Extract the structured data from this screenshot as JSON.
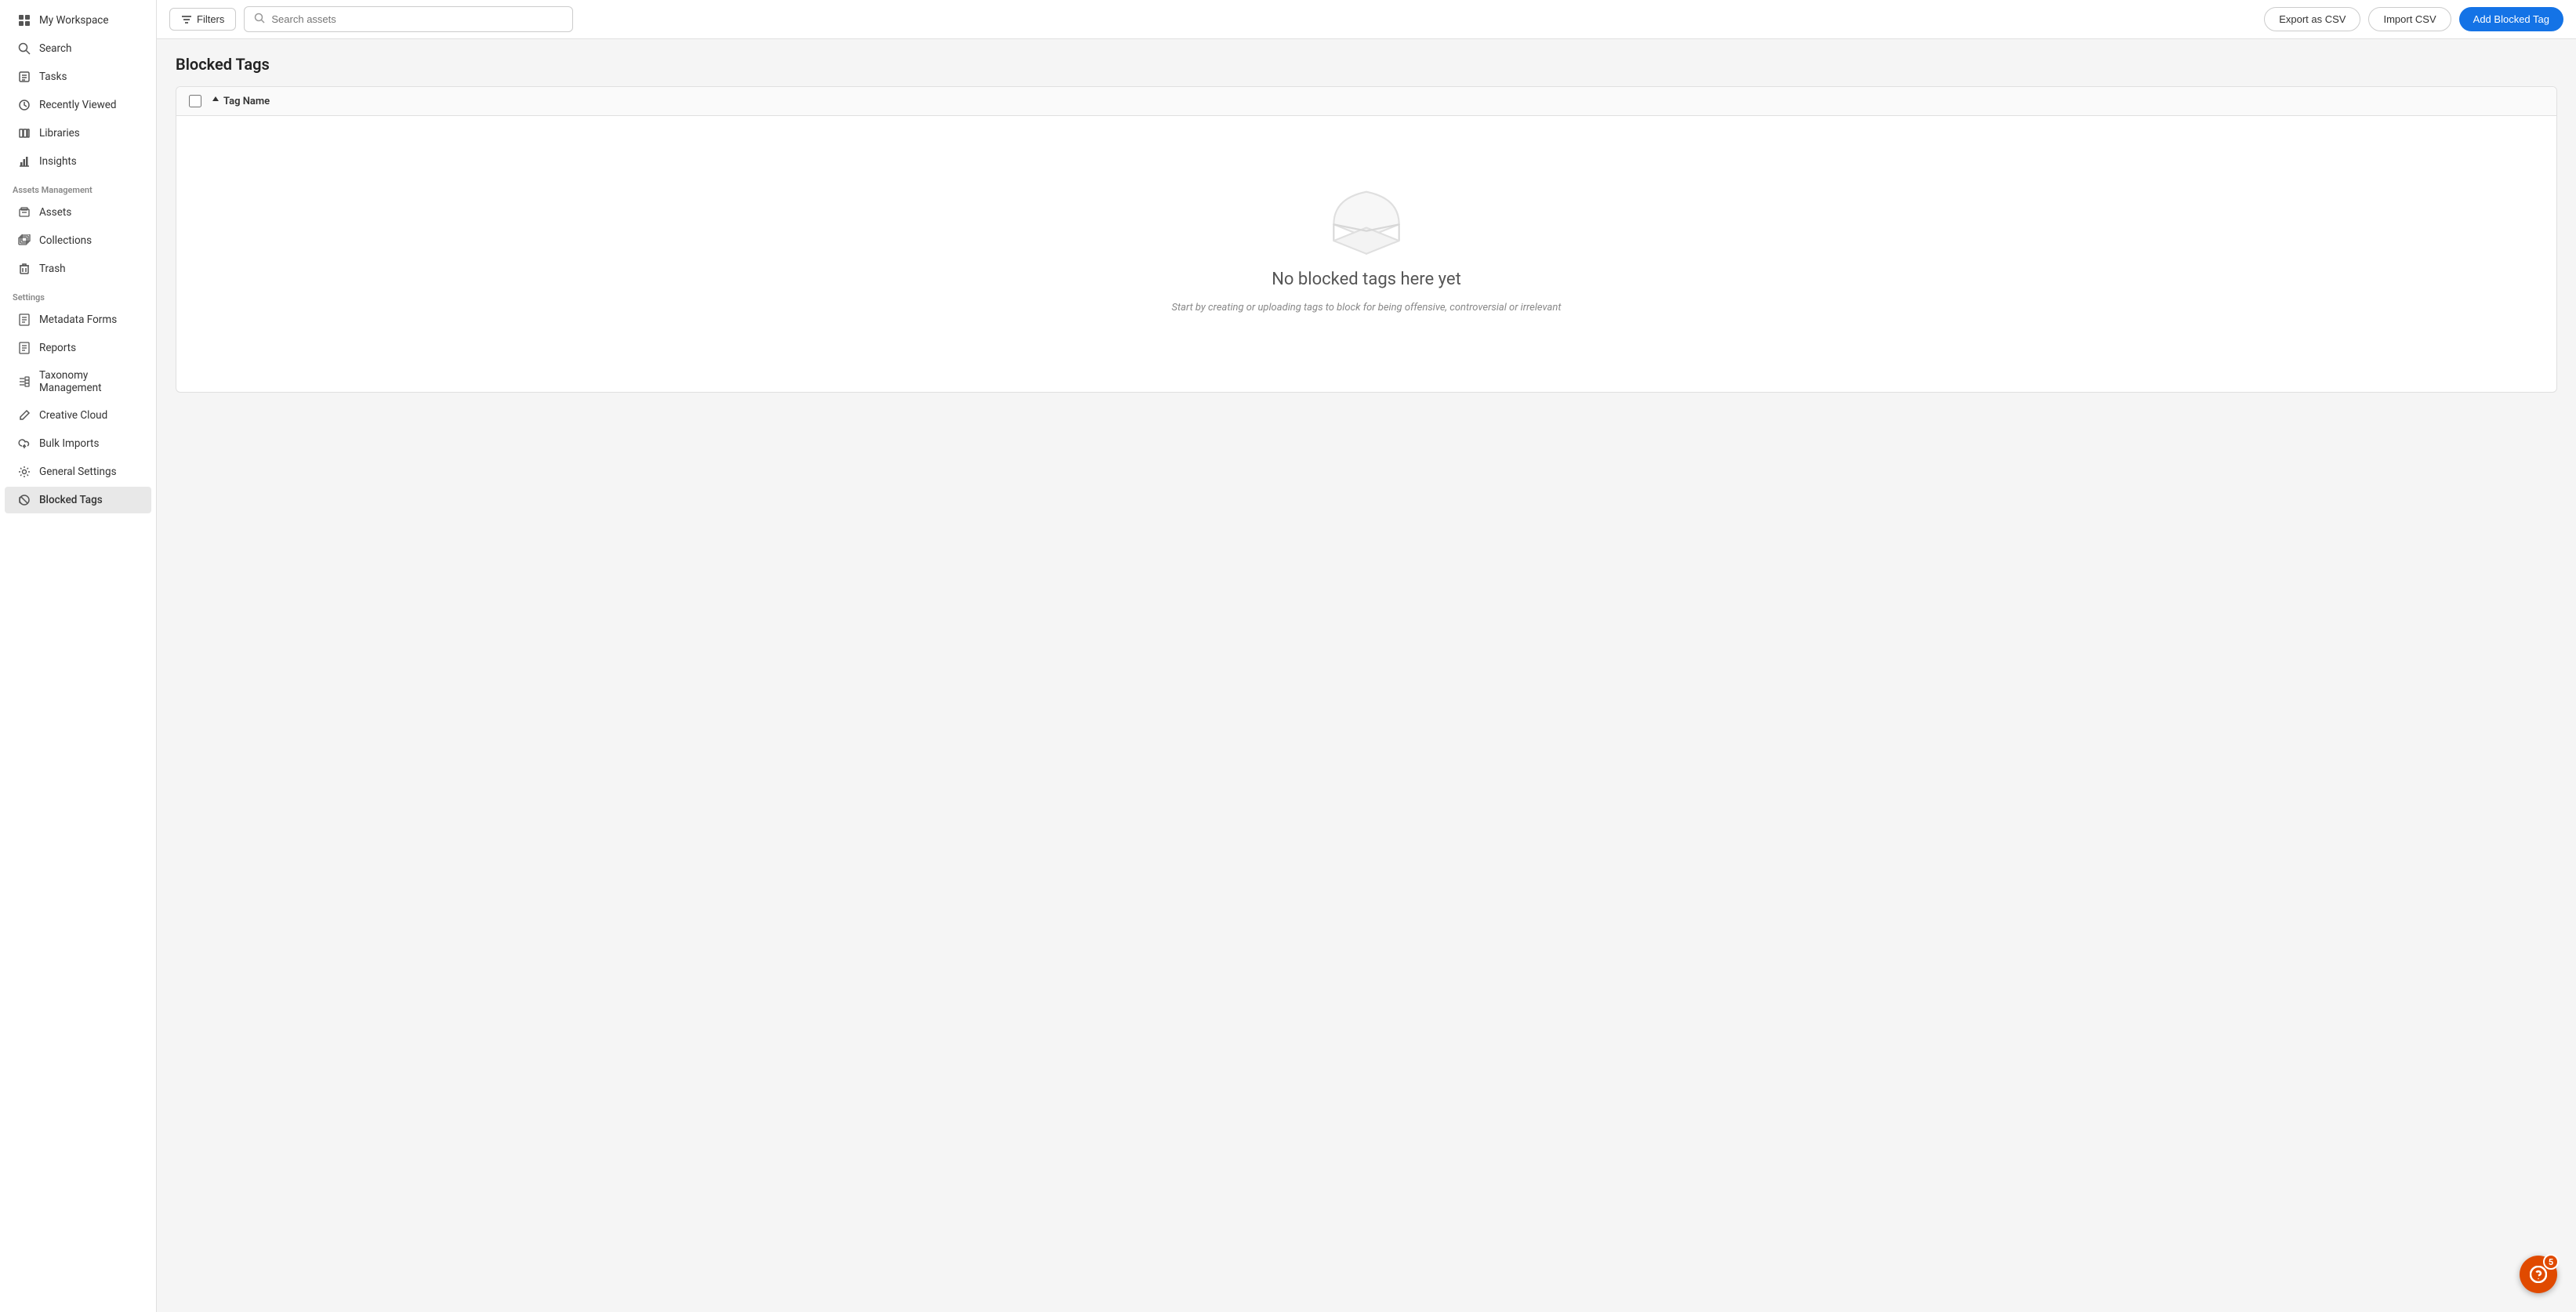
{
  "sidebar": {
    "items": [
      {
        "id": "my-workspace",
        "label": "My Workspace",
        "icon": "grid"
      },
      {
        "id": "search",
        "label": "Search",
        "icon": "search"
      },
      {
        "id": "tasks",
        "label": "Tasks",
        "icon": "tasks"
      },
      {
        "id": "recently-viewed",
        "label": "Recently Viewed",
        "icon": "clock"
      },
      {
        "id": "libraries",
        "label": "Libraries",
        "icon": "library"
      },
      {
        "id": "insights",
        "label": "Insights",
        "icon": "chart"
      }
    ],
    "sections": [
      {
        "label": "Assets Management",
        "items": [
          {
            "id": "assets",
            "label": "Assets",
            "icon": "assets"
          },
          {
            "id": "collections",
            "label": "Collections",
            "icon": "collections"
          },
          {
            "id": "trash",
            "label": "Trash",
            "icon": "trash"
          }
        ]
      },
      {
        "label": "Settings",
        "items": [
          {
            "id": "metadata-forms",
            "label": "Metadata Forms",
            "icon": "form"
          },
          {
            "id": "reports",
            "label": "Reports",
            "icon": "report"
          },
          {
            "id": "taxonomy-management",
            "label": "Taxonomy Management",
            "icon": "taxonomy"
          },
          {
            "id": "creative-cloud",
            "label": "Creative Cloud",
            "icon": "pen"
          },
          {
            "id": "bulk-imports",
            "label": "Bulk Imports",
            "icon": "cloud"
          },
          {
            "id": "general-settings",
            "label": "General Settings",
            "icon": "gear"
          },
          {
            "id": "blocked-tags",
            "label": "Blocked Tags",
            "icon": "blocked",
            "active": true
          }
        ]
      }
    ]
  },
  "topbar": {
    "filters_label": "Filters",
    "search_placeholder": "Search assets",
    "export_csv_label": "Export as CSV",
    "import_csv_label": "Import CSV",
    "add_blocked_tag_label": "Add Blocked Tag"
  },
  "page": {
    "title": "Blocked Tags",
    "table": {
      "column_tag_name": "Tag Name"
    },
    "empty_state": {
      "title": "No blocked tags here yet",
      "subtitle": "Start by creating or uploading tags to block for being offensive, controversial or irrelevant"
    }
  },
  "help": {
    "count": "5",
    "icon": "question-mark"
  }
}
